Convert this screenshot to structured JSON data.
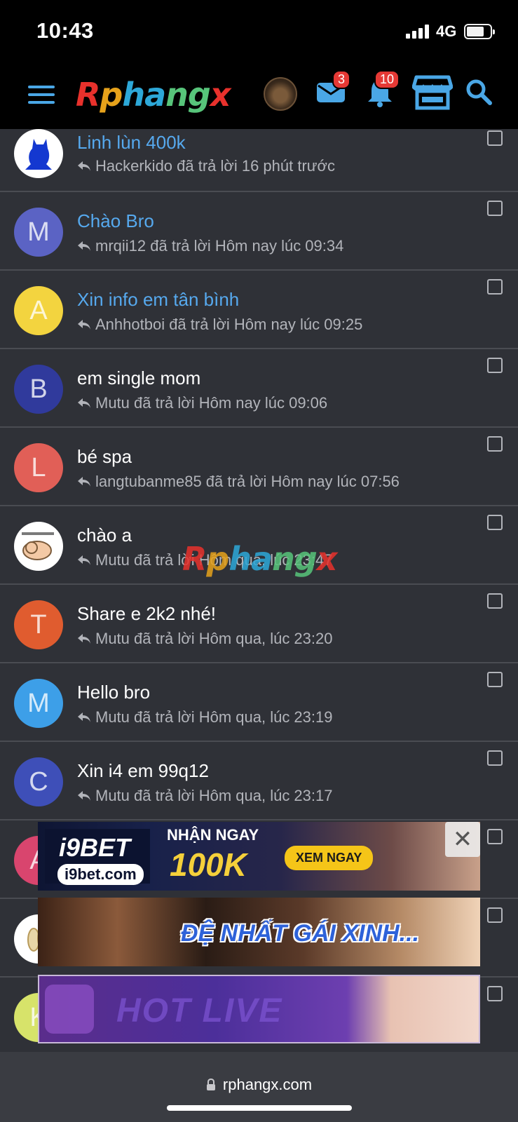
{
  "status_bar": {
    "time": "10:43",
    "network": "4G"
  },
  "header": {
    "logo_text": [
      "R",
      "p",
      "h",
      "a",
      "n",
      "g",
      "x"
    ],
    "messages_badge": "3",
    "alerts_badge": "10",
    "colors": {
      "accent": "#4aa7e6",
      "badge": "#e53935"
    }
  },
  "threads": [
    {
      "title": "Linh lùn 400k",
      "meta": "Hackerkido đã trả lời 16 phút trước",
      "unread": true,
      "avatar_letter": "",
      "avatar_color": "#ffffff"
    },
    {
      "title": "Chào Bro",
      "meta": "mrqii12 đã trả lời Hôm nay lúc 09:34",
      "unread": true,
      "avatar_letter": "M",
      "avatar_color": "#5b63c4"
    },
    {
      "title": "Xin info em tân bình",
      "meta": "Anhhotboi đã trả lời Hôm nay lúc 09:25",
      "unread": true,
      "avatar_letter": "A",
      "avatar_color": "#f3d43f"
    },
    {
      "title": "em single mom",
      "meta": "Mutu đã trả lời Hôm nay lúc 09:06",
      "unread": false,
      "avatar_letter": "B",
      "avatar_color": "#303a9c"
    },
    {
      "title": "bé spa",
      "meta": "langtubanme85 đã trả lời Hôm nay lúc 07:56",
      "unread": false,
      "avatar_letter": "L",
      "avatar_color": "#e15f57"
    },
    {
      "title": "chào a",
      "meta": "Mutu đã trả lời Hôm qua, lúc 23:47",
      "unread": false,
      "avatar_letter": "",
      "avatar_color": "#ffffff"
    },
    {
      "title": "Share e 2k2 nhé!",
      "meta": "Mutu đã trả lời Hôm qua, lúc 23:20",
      "unread": false,
      "avatar_letter": "T",
      "avatar_color": "#e05c2f"
    },
    {
      "title": "Hello bro",
      "meta": "Mutu đã trả lời Hôm qua, lúc 23:19",
      "unread": false,
      "avatar_letter": "M",
      "avatar_color": "#3d9fe8"
    },
    {
      "title": "Xin i4 em 99q12",
      "meta": "Mutu đã trả lời Hôm qua, lúc 23:17",
      "unread": false,
      "avatar_letter": "C",
      "avatar_color": "#3e4fb8"
    },
    {
      "title": "",
      "meta": "",
      "unread": false,
      "avatar_letter": "A",
      "avatar_color": "#d9456e"
    },
    {
      "title": "",
      "meta": "",
      "unread": false,
      "avatar_letter": "",
      "avatar_color": "#ffffff"
    },
    {
      "title": "",
      "meta": "",
      "unread": false,
      "avatar_letter": "K",
      "avatar_color": "#d7e36a"
    }
  ],
  "watermark": [
    "R",
    "p",
    "h",
    "a",
    "n",
    "g",
    "x"
  ],
  "banners": {
    "b1": {
      "brand": "i9BET",
      "domain": "i9bet.com",
      "headline": "NHẬN NGAY",
      "amount": "100K",
      "cta": "XEM NGAY",
      "close": "✕"
    },
    "b2": {
      "text": "ĐỆ NHẤT GÁI XINH..."
    },
    "b3": {
      "text": "HOT LIVE"
    }
  },
  "footer": {
    "url": "rphangx.com"
  }
}
